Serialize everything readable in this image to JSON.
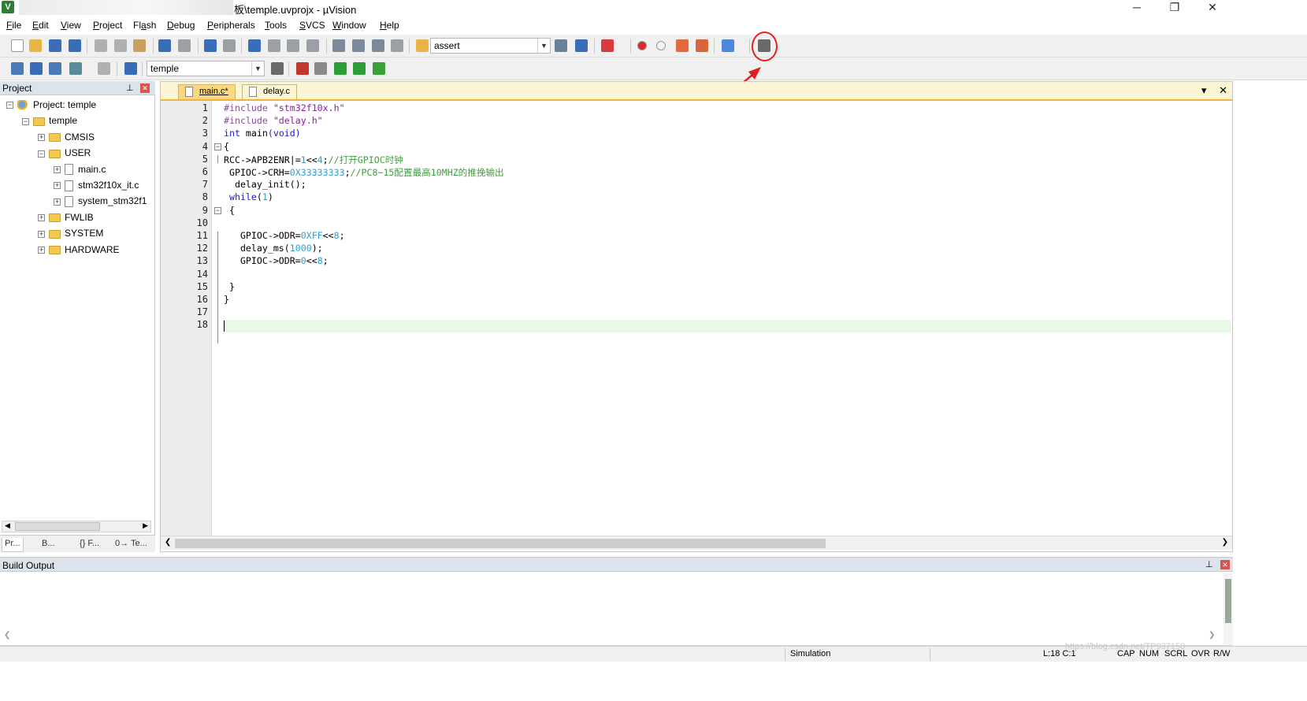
{
  "window": {
    "title": "板\\temple.uvprojx - µVision",
    "app_icon": "V",
    "controls": {
      "minimize": "─",
      "restore": "❐",
      "close": "✕"
    }
  },
  "menu": [
    {
      "label": "File",
      "key": "F"
    },
    {
      "label": "Edit",
      "key": "E"
    },
    {
      "label": "View",
      "key": "V"
    },
    {
      "label": "Project",
      "key": "P"
    },
    {
      "label": "Flash",
      "key": "a"
    },
    {
      "label": "Debug",
      "key": "D"
    },
    {
      "label": "Peripherals",
      "key": "P"
    },
    {
      "label": "Tools",
      "key": "T"
    },
    {
      "label": "SVCS",
      "key": "S"
    },
    {
      "label": "Window",
      "key": "W"
    },
    {
      "label": "Help",
      "key": "H"
    }
  ],
  "toolbar1": {
    "find_combo_value": "assert",
    "icons": [
      "new-file-icon",
      "open-file-icon",
      "save-icon",
      "save-all-icon",
      "cut-icon",
      "copy-icon",
      "paste-icon",
      "undo-icon",
      "redo-icon",
      "nav-back-icon",
      "nav-forward-icon",
      "bookmark-insert-icon",
      "bookmark-prev-icon",
      "bookmark-next-icon",
      "bookmark-clear-icon",
      "indent-icon",
      "unindent-icon",
      "comment-icon",
      "uncomment-icon",
      "find-in-files-icon",
      "find-icon",
      "incremental-find-icon",
      "debug-session-icon",
      "breakpoint-insert-icon",
      "breakpoint-disable-icon",
      "breakpoint-disable-all-icon",
      "breakpoint-kill-all-icon",
      "window-layout-icon",
      "configure-wrench-icon"
    ]
  },
  "toolbar2": {
    "target_combo_value": "temple",
    "icons": [
      "translate-icon",
      "build-icon",
      "rebuild-icon",
      "batch-build-icon",
      "stop-build-icon",
      "download-icon",
      "options-for-target-icon",
      "manage-project-items-icon",
      "select-packs-icon",
      "manage-rte-icon",
      "pack-installer-icon",
      "event-recorder-icon"
    ]
  },
  "project_panel": {
    "title": "Project",
    "pin_icon": "pin-icon",
    "close_icon": "close-icon",
    "tree": [
      {
        "label": "Project: temple",
        "level": 0,
        "kind": "project",
        "expander": "−"
      },
      {
        "label": "temple",
        "level": 1,
        "kind": "target",
        "expander": "−"
      },
      {
        "label": "CMSIS",
        "level": 2,
        "kind": "folder",
        "expander": "+"
      },
      {
        "label": "USER",
        "level": 2,
        "kind": "folder",
        "expander": "−"
      },
      {
        "label": "main.c",
        "level": 3,
        "kind": "file",
        "expander": "+"
      },
      {
        "label": "stm32f10x_it.c",
        "level": 3,
        "kind": "file",
        "expander": "+"
      },
      {
        "label": "system_stm32f1",
        "level": 3,
        "kind": "file",
        "expander": "+"
      },
      {
        "label": "FWLIB",
        "level": 2,
        "kind": "folder",
        "expander": "+"
      },
      {
        "label": "SYSTEM",
        "level": 2,
        "kind": "folder",
        "expander": "+"
      },
      {
        "label": "HARDWARE",
        "level": 2,
        "kind": "folder",
        "expander": "+"
      }
    ],
    "bottom_tabs": [
      "Pr...",
      "B...",
      "{} F...",
      "0→ Te..."
    ]
  },
  "editor": {
    "tabs": [
      {
        "label": "main.c*",
        "active": true
      },
      {
        "label": "delay.c",
        "active": false
      }
    ],
    "current_line": 18,
    "lines": [
      [
        {
          "t": "#include ",
          "c": "pp"
        },
        {
          "t": "\"stm32f10x.h\"",
          "c": "str"
        }
      ],
      [
        {
          "t": "#include ",
          "c": "pp"
        },
        {
          "t": "\"delay.h\"",
          "c": "str"
        }
      ],
      [
        {
          "t": "int",
          "c": "kw"
        },
        {
          "t": " main",
          "c": ""
        },
        {
          "t": "(void)",
          "c": "kw"
        }
      ],
      [
        {
          "t": "{",
          "c": ""
        }
      ],
      [
        {
          "t": "RCC->APB2ENR|=",
          "c": ""
        },
        {
          "t": "1",
          "c": "num"
        },
        {
          "t": "<<",
          "c": ""
        },
        {
          "t": "4",
          "c": "num"
        },
        {
          "t": ";",
          "c": ""
        },
        {
          "t": "//打开GPIOC时钟",
          "c": "cm"
        }
      ],
      [
        {
          "t": " GPIOC->CRH=",
          "c": ""
        },
        {
          "t": "0X33333333",
          "c": "num"
        },
        {
          "t": ";",
          "c": ""
        },
        {
          "t": "//PC8~15配置最高10MHZ的推挽输出",
          "c": "cm"
        }
      ],
      [
        {
          "t": "  delay_init();",
          "c": ""
        }
      ],
      [
        {
          "t": " ",
          "c": ""
        },
        {
          "t": "while",
          "c": "kw"
        },
        {
          "t": "(",
          "c": ""
        },
        {
          "t": "1",
          "c": "num"
        },
        {
          "t": ")",
          "c": ""
        }
      ],
      [
        {
          "t": " {",
          "c": ""
        }
      ],
      [
        {
          "t": "",
          "c": ""
        }
      ],
      [
        {
          "t": "   GPIOC->ODR=",
          "c": ""
        },
        {
          "t": "0XFF",
          "c": "num"
        },
        {
          "t": "<<",
          "c": ""
        },
        {
          "t": "8",
          "c": "num"
        },
        {
          "t": ";",
          "c": ""
        }
      ],
      [
        {
          "t": "   delay_ms(",
          "c": ""
        },
        {
          "t": "1000",
          "c": "num"
        },
        {
          "t": ");",
          "c": ""
        }
      ],
      [
        {
          "t": "   GPIOC->ODR=",
          "c": ""
        },
        {
          "t": "0",
          "c": "num"
        },
        {
          "t": "<<",
          "c": ""
        },
        {
          "t": "8",
          "c": "num"
        },
        {
          "t": ";",
          "c": ""
        }
      ],
      [
        {
          "t": "",
          "c": ""
        }
      ],
      [
        {
          "t": " }",
          "c": ""
        }
      ],
      [
        {
          "t": "}",
          "c": ""
        }
      ],
      [
        {
          "t": "",
          "c": ""
        }
      ],
      [
        {
          "t": "",
          "c": ""
        }
      ]
    ],
    "folds": {
      "4": "−",
      "9": "−"
    }
  },
  "build_output": {
    "title": "Build Output"
  },
  "status": {
    "mode": "Simulation",
    "position": "L:18 C:1",
    "indicators": [
      "CAP",
      "NUM",
      "SCRL",
      "OVR",
      "R/W"
    ],
    "watermark": "https://blog.csdn.net/TP937150"
  },
  "colors": {
    "annotation": "#e02020",
    "active_tab": "#fbd77d",
    "tab_strip": "#fbf5d3"
  }
}
